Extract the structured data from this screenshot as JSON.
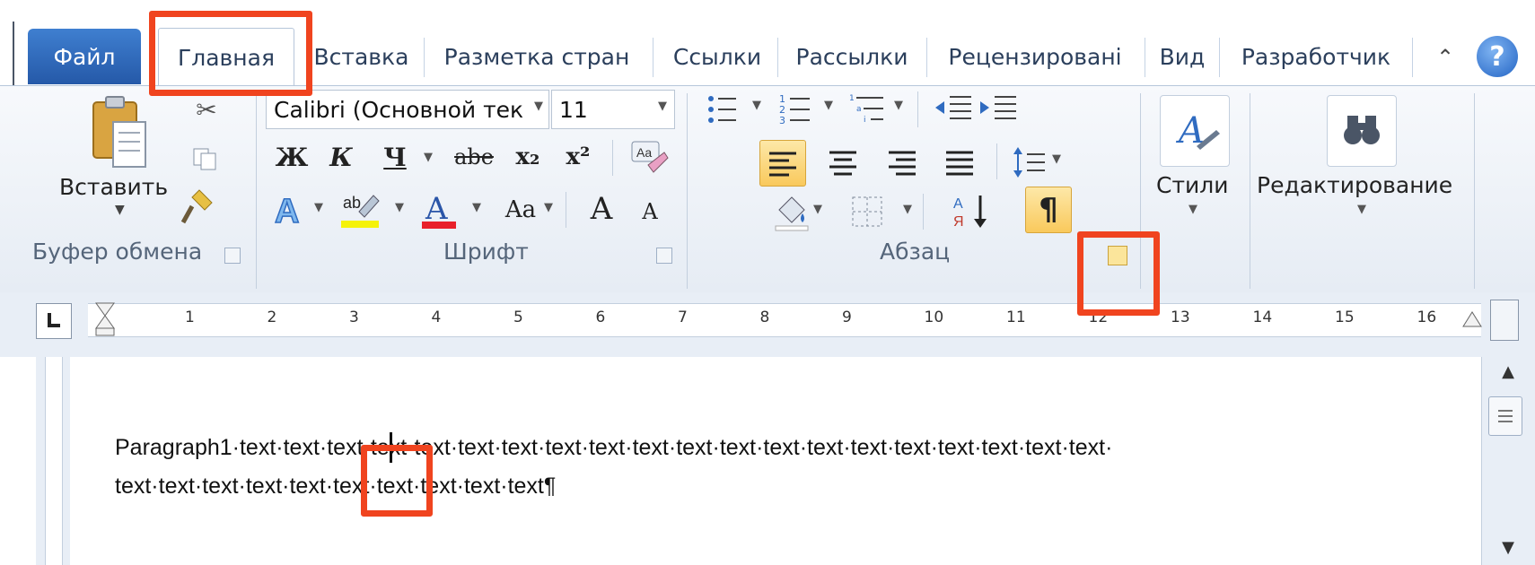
{
  "tabs": {
    "file": "Файл",
    "home": "Главная",
    "insert": "Вставка",
    "layout": "Разметка стран",
    "references": "Ссылки",
    "mailings": "Рассылки",
    "review": "Рецензировані",
    "view": "Вид",
    "developer": "Разработчик"
  },
  "clipboard": {
    "paste_label": "Вставить",
    "group_label": "Буфер обмена"
  },
  "font": {
    "name": "Calibri (Основной тек",
    "size": "11",
    "bold": "Ж",
    "italic": "К",
    "underline": "Ч",
    "strike": "abe",
    "subscript": "x₂",
    "superscript": "x²",
    "change_case": "Aa",
    "grow": "A",
    "shrink": "A",
    "group_label": "Шрифт"
  },
  "paragraph": {
    "pilcrow": "¶",
    "group_label": "Абзац"
  },
  "styles": {
    "label": "Стили"
  },
  "editing": {
    "label": "Редактирование"
  },
  "ruler": {
    "numbers": [
      "1",
      "2",
      "3",
      "4",
      "5",
      "6",
      "7",
      "8",
      "9",
      "10",
      "11",
      "12",
      "13",
      "14",
      "15",
      "16"
    ]
  },
  "document": {
    "line1_before": "Paragraph1·text·te",
    "line1_mid": "xt·te",
    "line1_after": "xt·text·text·text·text·text·text·text·text·text·text·text·text·text·text·text·text·text·",
    "line2": "text·text·text·text·text·text·text·text·text·text¶"
  },
  "colors": {
    "accent_red": "#f0441f",
    "file_tab": "#2f6bc0",
    "highlight": "#f9c95c"
  }
}
